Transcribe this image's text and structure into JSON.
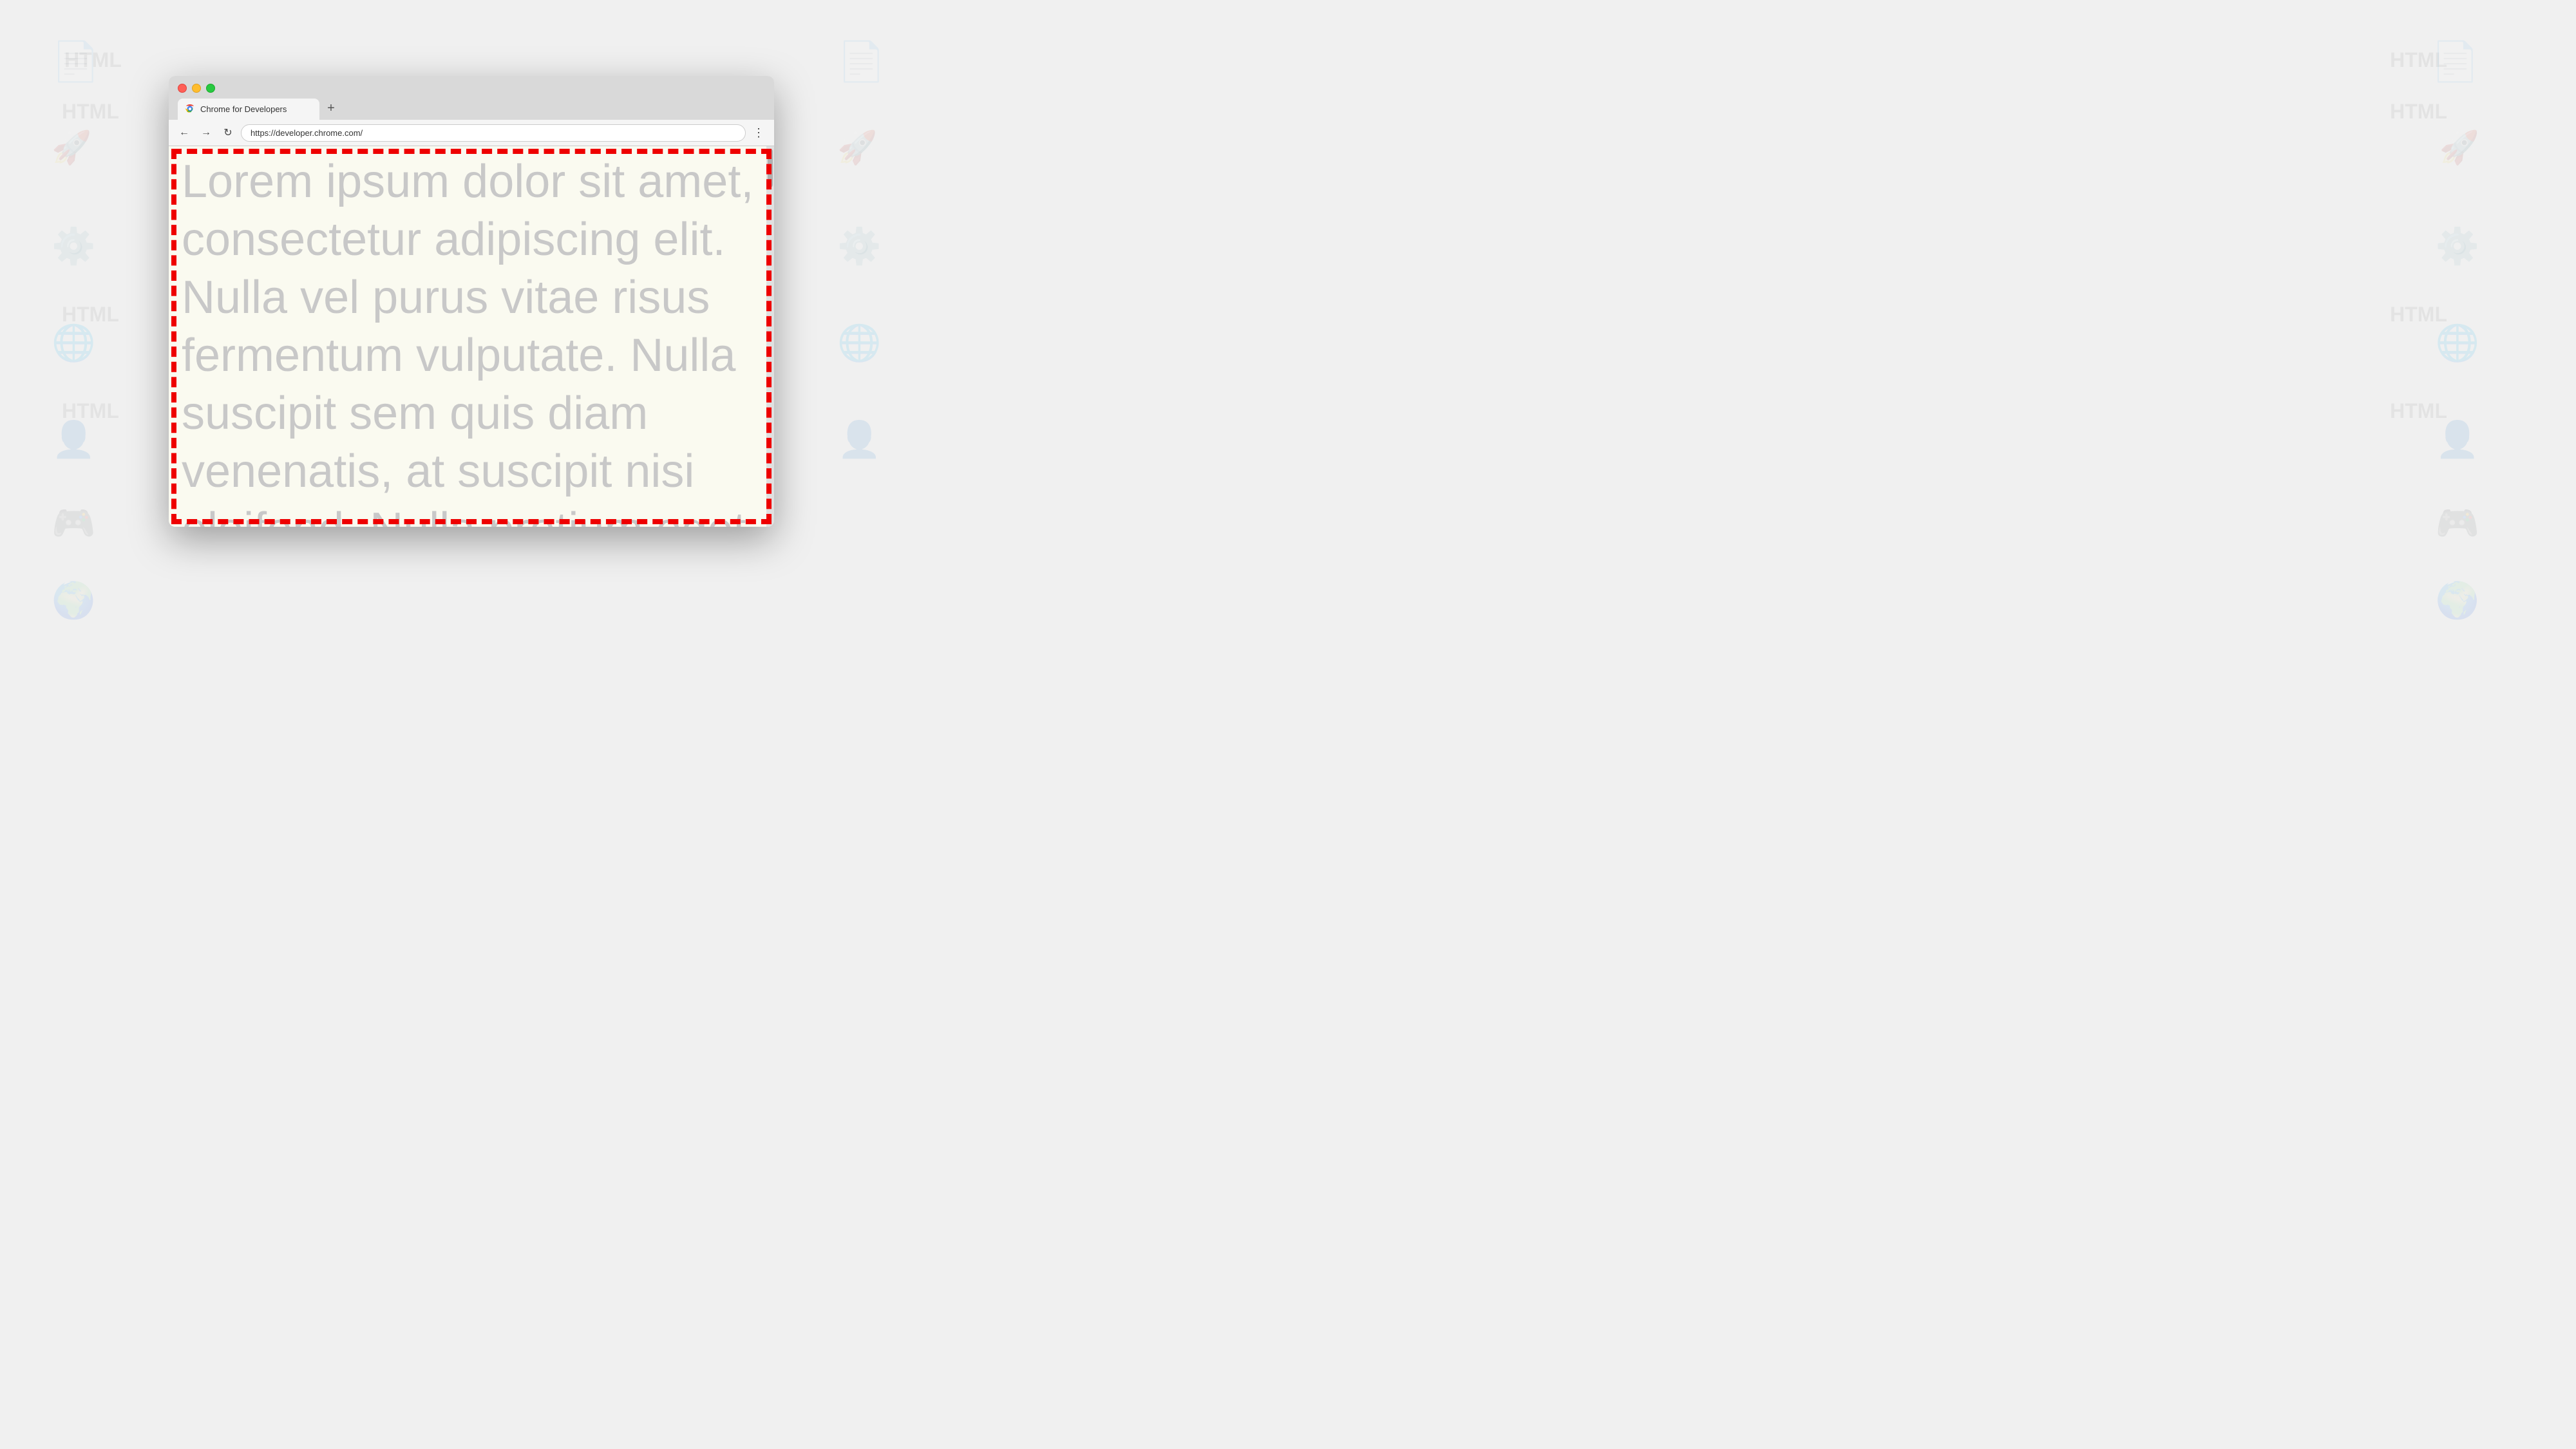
{
  "background": {
    "color": "#f0f0f0"
  },
  "browser": {
    "tab": {
      "title": "Chrome for Developers",
      "favicon": "chrome-logo"
    },
    "new_tab_label": "+",
    "nav": {
      "back_icon": "←",
      "forward_icon": "→",
      "refresh_icon": "↻",
      "url": "https://developer.chrome.com/",
      "menu_icon": "⋮"
    },
    "page": {
      "lorem_text": "Lorem ipsum dolor sit amet, consectetur adipiscing elit. Nulla vel purus vitae risus fermentum vulputate. Nulla suscipit sem quis diam venenatis, at suscipit nisi eleifend. Nulla pretium eget",
      "border_color": "#dd0000",
      "bg_color": "#fafaf0"
    }
  },
  "traffic_lights": {
    "close_color": "#ff5f57",
    "minimize_color": "#ffbd2e",
    "maximize_color": "#28c941"
  }
}
